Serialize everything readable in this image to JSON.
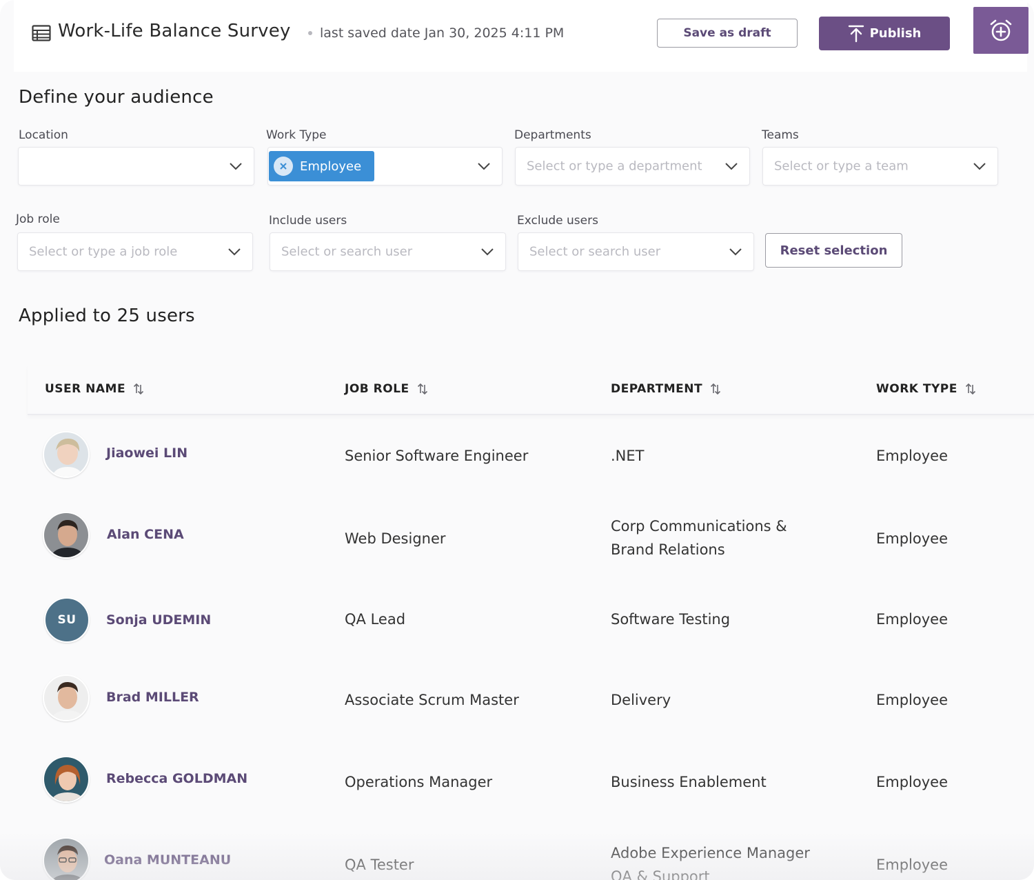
{
  "header": {
    "title": "Work-Life Balance Survey",
    "saved_text": "last saved date Jan 30, 2025 4:11 PM",
    "save_draft_label": "Save as draft",
    "publish_label": "Publish"
  },
  "audience": {
    "title": "Define your audience",
    "location": {
      "label": "Location",
      "value": ""
    },
    "work_type": {
      "label": "Work Type",
      "chip": "Employee"
    },
    "departments": {
      "label": "Departments",
      "placeholder": "Select or type a department"
    },
    "teams": {
      "label": "Teams",
      "placeholder": "Select or type a team"
    },
    "job_role": {
      "label": "Job role",
      "placeholder": "Select or type a job role"
    },
    "include_users": {
      "label": "Include users",
      "placeholder": "Select or search user"
    },
    "exclude_users": {
      "label": "Exclude users",
      "placeholder": "Select or search user"
    },
    "reset_label": "Reset selection"
  },
  "applied": {
    "title": "Applied to 25 users"
  },
  "table": {
    "columns": [
      "USER NAME",
      "JOB ROLE",
      "DEPARTMENT",
      "WORK TYPE"
    ],
    "rows": [
      {
        "name": "Jiaowei LIN",
        "job_role": "Senior Software Engineer",
        "department": ".NET",
        "work_type": "Employee",
        "avatar": "photo"
      },
      {
        "name": "Alan CENA",
        "job_role": "Web Designer",
        "department": "Corp Communications & Brand Relations",
        "work_type": "Employee",
        "avatar": "photo"
      },
      {
        "name": "Sonja UDEMIN",
        "job_role": "QA Lead",
        "department": "Software Testing",
        "work_type": "Employee",
        "avatar": "initials",
        "initials": "SU"
      },
      {
        "name": "Brad MILLER",
        "job_role": "Associate Scrum Master",
        "department": "Delivery",
        "work_type": "Employee",
        "avatar": "photo"
      },
      {
        "name": "Rebecca GOLDMAN",
        "job_role": "Operations Manager",
        "department": "Business Enablement",
        "work_type": "Employee",
        "avatar": "photo"
      },
      {
        "name": "Oana MUNTEANU",
        "job_role": "QA Tester",
        "department": "Adobe Experience Manager QA & Support",
        "work_type": "Employee",
        "avatar": "photo"
      }
    ]
  },
  "colors": {
    "accent": "#6b4f85",
    "chip": "#3b8fd6",
    "name_text": "#5b4a76",
    "initials_avatar": "#4d7188"
  },
  "icons": {
    "title": "list-document-icon",
    "publish": "upload-icon",
    "alarm": "alarm-add-icon",
    "select": "chevron-down-icon",
    "chip_remove": "close-circle-icon",
    "sort": "sort-arrows-icon"
  }
}
